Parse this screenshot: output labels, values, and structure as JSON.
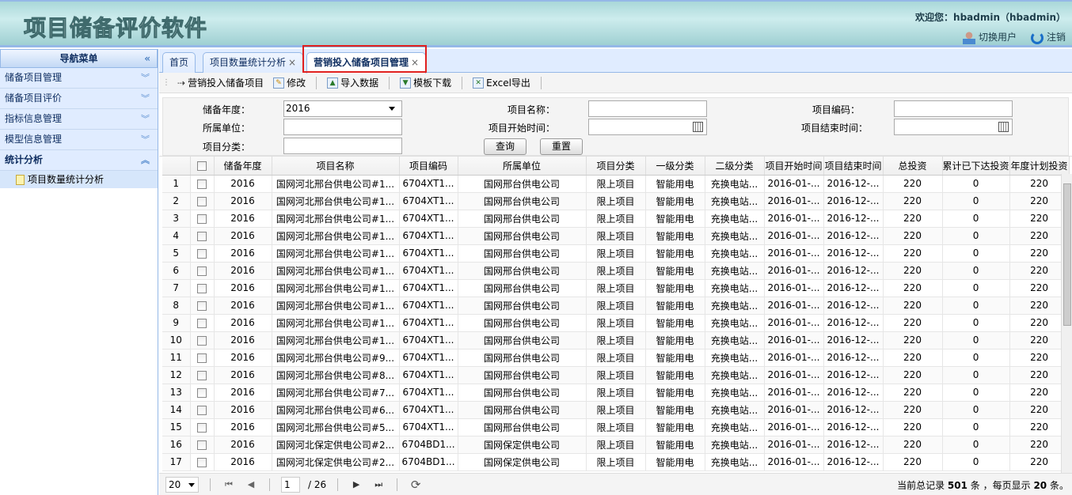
{
  "header": {
    "app_title": "项目储备评价软件",
    "welcome": "欢迎您：hbadmin（hbadmin）",
    "switch_user": "切换用户",
    "logout": "注销"
  },
  "sidebar": {
    "title": "导航菜单",
    "items": [
      {
        "label": "储备项目管理",
        "expanded": false
      },
      {
        "label": "储备项目评价",
        "expanded": false
      },
      {
        "label": "指标信息管理",
        "expanded": false
      },
      {
        "label": "模型信息管理",
        "expanded": false
      },
      {
        "label": "统计分析",
        "expanded": true
      }
    ],
    "sub_items": [
      {
        "label": "项目数量统计分析"
      }
    ]
  },
  "tabs": [
    {
      "label": "首页"
    },
    {
      "label": "项目数量统计分析",
      "closable": true
    },
    {
      "label": "营销投入储备项目管理",
      "closable": true,
      "active": true
    }
  ],
  "tab_close": "×",
  "toolbar": {
    "title": "营销投入储备项目",
    "edit": "修改",
    "import": "导入数据",
    "template": "模板下载",
    "export": "Excel导出"
  },
  "form": {
    "year_label": "储备年度：",
    "year_value": "2016",
    "name_label": "项目名称：",
    "name_value": "",
    "code_label": "项目编码：",
    "code_value": "",
    "unit_label": "所属单位：",
    "unit_value": "",
    "start_label": "项目开始时间：",
    "start_value": "",
    "end_label": "项目结束时间：",
    "end_value": "",
    "category_label": "项目分类：",
    "category_value": "",
    "query": "查询",
    "reset": "重置"
  },
  "grid": {
    "columns": [
      "",
      "",
      "储备年度",
      "项目名称",
      "项目编码",
      "所属单位",
      "项目分类",
      "一级分类",
      "二级分类",
      "项目开始时间",
      "项目结束时间",
      "总投资",
      "累计已下达投资",
      "年度计划投资"
    ],
    "rows": [
      [
        "1",
        "2016",
        "国网河北邢台供电公司#1...",
        "6704XT1...",
        "国网邢台供电公司",
        "限上项目",
        "智能用电",
        "充换电站...",
        "2016-01-...",
        "2016-12-...",
        "220",
        "0",
        "220"
      ],
      [
        "2",
        "2016",
        "国网河北邢台供电公司#1...",
        "6704XT1...",
        "国网邢台供电公司",
        "限上项目",
        "智能用电",
        "充换电站...",
        "2016-01-...",
        "2016-12-...",
        "220",
        "0",
        "220"
      ],
      [
        "3",
        "2016",
        "国网河北邢台供电公司#1...",
        "6704XT1...",
        "国网邢台供电公司",
        "限上项目",
        "智能用电",
        "充换电站...",
        "2016-01-...",
        "2016-12-...",
        "220",
        "0",
        "220"
      ],
      [
        "4",
        "2016",
        "国网河北邢台供电公司#1...",
        "6704XT1...",
        "国网邢台供电公司",
        "限上项目",
        "智能用电",
        "充换电站...",
        "2016-01-...",
        "2016-12-...",
        "220",
        "0",
        "220"
      ],
      [
        "5",
        "2016",
        "国网河北邢台供电公司#1...",
        "6704XT1...",
        "国网邢台供电公司",
        "限上项目",
        "智能用电",
        "充换电站...",
        "2016-01-...",
        "2016-12-...",
        "220",
        "0",
        "220"
      ],
      [
        "6",
        "2016",
        "国网河北邢台供电公司#1...",
        "6704XT1...",
        "国网邢台供电公司",
        "限上项目",
        "智能用电",
        "充换电站...",
        "2016-01-...",
        "2016-12-...",
        "220",
        "0",
        "220"
      ],
      [
        "7",
        "2016",
        "国网河北邢台供电公司#1...",
        "6704XT1...",
        "国网邢台供电公司",
        "限上项目",
        "智能用电",
        "充换电站...",
        "2016-01-...",
        "2016-12-...",
        "220",
        "0",
        "220"
      ],
      [
        "8",
        "2016",
        "国网河北邢台供电公司#1...",
        "6704XT1...",
        "国网邢台供电公司",
        "限上项目",
        "智能用电",
        "充换电站...",
        "2016-01-...",
        "2016-12-...",
        "220",
        "0",
        "220"
      ],
      [
        "9",
        "2016",
        "国网河北邢台供电公司#1...",
        "6704XT1...",
        "国网邢台供电公司",
        "限上项目",
        "智能用电",
        "充换电站...",
        "2016-01-...",
        "2016-12-...",
        "220",
        "0",
        "220"
      ],
      [
        "10",
        "2016",
        "国网河北邢台供电公司#1...",
        "6704XT1...",
        "国网邢台供电公司",
        "限上项目",
        "智能用电",
        "充换电站...",
        "2016-01-...",
        "2016-12-...",
        "220",
        "0",
        "220"
      ],
      [
        "11",
        "2016",
        "国网河北邢台供电公司#9...",
        "6704XT1...",
        "国网邢台供电公司",
        "限上项目",
        "智能用电",
        "充换电站...",
        "2016-01-...",
        "2016-12-...",
        "220",
        "0",
        "220"
      ],
      [
        "12",
        "2016",
        "国网河北邢台供电公司#8...",
        "6704XT1...",
        "国网邢台供电公司",
        "限上项目",
        "智能用电",
        "充换电站...",
        "2016-01-...",
        "2016-12-...",
        "220",
        "0",
        "220"
      ],
      [
        "13",
        "2016",
        "国网河北邢台供电公司#7...",
        "6704XT1...",
        "国网邢台供电公司",
        "限上项目",
        "智能用电",
        "充换电站...",
        "2016-01-...",
        "2016-12-...",
        "220",
        "0",
        "220"
      ],
      [
        "14",
        "2016",
        "国网河北邢台供电公司#6...",
        "6704XT1...",
        "国网邢台供电公司",
        "限上项目",
        "智能用电",
        "充换电站...",
        "2016-01-...",
        "2016-12-...",
        "220",
        "0",
        "220"
      ],
      [
        "15",
        "2016",
        "国网河北邢台供电公司#5...",
        "6704XT1...",
        "国网邢台供电公司",
        "限上项目",
        "智能用电",
        "充换电站...",
        "2016-01-...",
        "2016-12-...",
        "220",
        "0",
        "220"
      ],
      [
        "16",
        "2016",
        "国网河北保定供电公司#2...",
        "6704BD1...",
        "国网保定供电公司",
        "限上项目",
        "智能用电",
        "充换电站...",
        "2016-01-...",
        "2016-12-...",
        "220",
        "0",
        "220"
      ],
      [
        "17",
        "2016",
        "国网河北保定供电公司#2...",
        "6704BD1...",
        "国网保定供电公司",
        "限上项目",
        "智能用电",
        "充换电站...",
        "2016-01-...",
        "2016-12-...",
        "220",
        "0",
        "220"
      ]
    ]
  },
  "pager": {
    "page_size": "20",
    "page": "1",
    "total_pages": "/ 26",
    "info_prefix": "当前总记录",
    "total": "501",
    "info_mid": "条 ，每页显示",
    "per_page": "20",
    "info_suffix": "条。"
  },
  "colors": {
    "accent": "#95b8e7",
    "highlight": "#e0201e",
    "nav_bg": "#e0ecff"
  }
}
